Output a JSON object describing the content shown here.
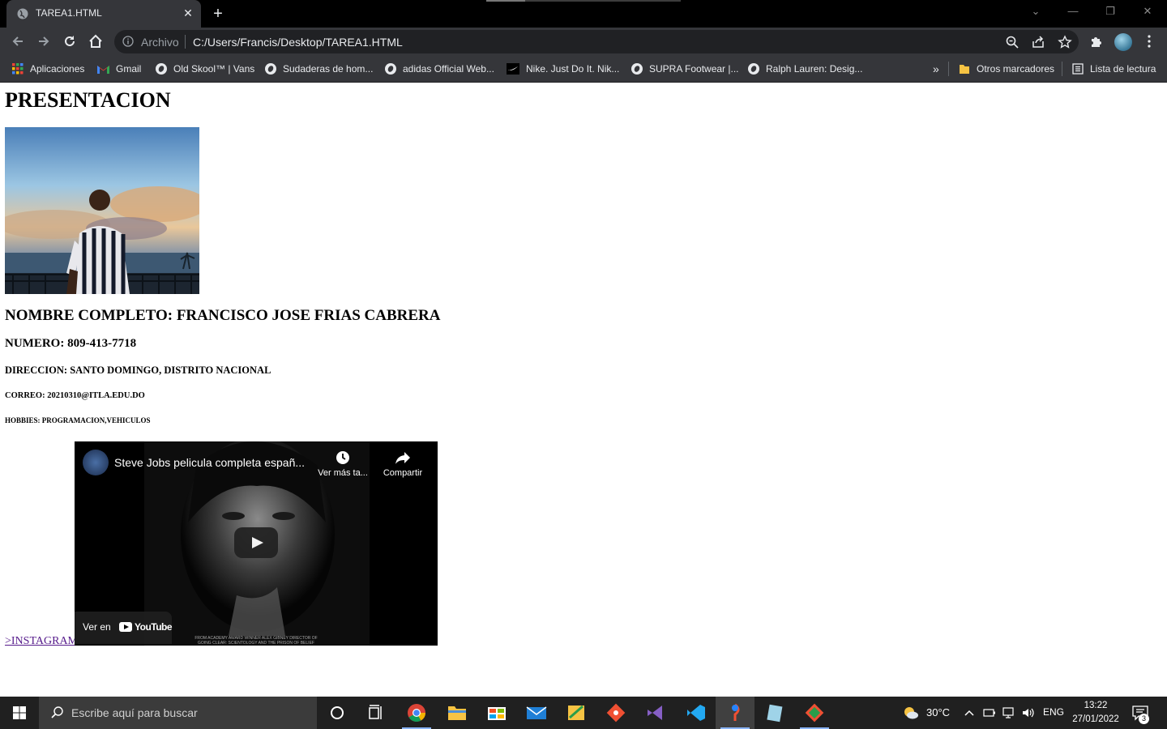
{
  "browser": {
    "tab_title": "TAREA1.HTML",
    "close_symbol": "✕",
    "new_tab_symbol": "+",
    "omnibox": {
      "security_label": "Archivo",
      "url": "C:/Users/Francis/Desktop/TAREA1.HTML"
    },
    "window_controls": [
      "⌄",
      "—",
      "❐",
      "✕"
    ],
    "bookmarks": [
      {
        "label": "Aplicaciones",
        "icon": "apps-grid-icon"
      },
      {
        "label": "Gmail",
        "icon": "gmail-icon"
      },
      {
        "label": "Old Skool™ | Vans",
        "icon": "globe-icon"
      },
      {
        "label": "Sudaderas de hom...",
        "icon": "globe-icon"
      },
      {
        "label": "adidas Official Web...",
        "icon": "globe-icon"
      },
      {
        "label": "Nike. Just Do It. Nik...",
        "icon": "nike-icon"
      },
      {
        "label": "SUPRA Footwear |...",
        "icon": "globe-icon"
      },
      {
        "label": "Ralph Lauren: Desig...",
        "icon": "globe-icon"
      }
    ],
    "bookmarks_overflow": "»",
    "other_bookmarks": "Otros marcadores",
    "reading_list": "Lista de lectura"
  },
  "page": {
    "heading": "PRESENTACION",
    "full_name": "NOMBRE COMPLETO: FRANCISCO JOSE FRIAS CABRERA",
    "phone": "NUMERO: 809-413-7718",
    "address": "DIRECCION: SANTO DOMINGO, DISTRITO NACIONAL",
    "email": "CORREO: 20210310@ITLA.EDU.DO",
    "hobbies": "HOBBIES: PROGRAMACION,VEHICULOS",
    "instagram_link": ">INSTAGRAM",
    "video": {
      "title": "Steve Jobs pelicula completa españ...",
      "watch_later": "Ver más ta...",
      "share": "Compartir",
      "watch_on": "Ver en",
      "youtube": "YouTube",
      "credit_line1": "FROM ACADEMY AWARD WINNER ALEX GIBNEY DIRECTOR OF",
      "credit_line2": "GOING CLEAR: SCIENTOLOGY AND THE PRISON OF BELIEF"
    }
  },
  "taskbar": {
    "search_placeholder": "Escribe aquí para buscar",
    "weather": "30°C",
    "language": "ENG",
    "time": "13:22",
    "date": "27/01/2022",
    "notifications": "3",
    "apps": [
      "cortana-icon",
      "task-view-icon",
      "chrome-icon",
      "file-explorer-icon",
      "store-icon",
      "mail-icon",
      "sticky-app-icon",
      "git-icon",
      "visual-studio-icon",
      "vscode-icon",
      "sourcetree-icon",
      "notepad-icon",
      "git-gui-icon"
    ]
  },
  "colors": {
    "chrome_dark": "#35363a",
    "titlebar": "#000000",
    "link_visited": "#551a8b",
    "taskbar": "#202020"
  }
}
